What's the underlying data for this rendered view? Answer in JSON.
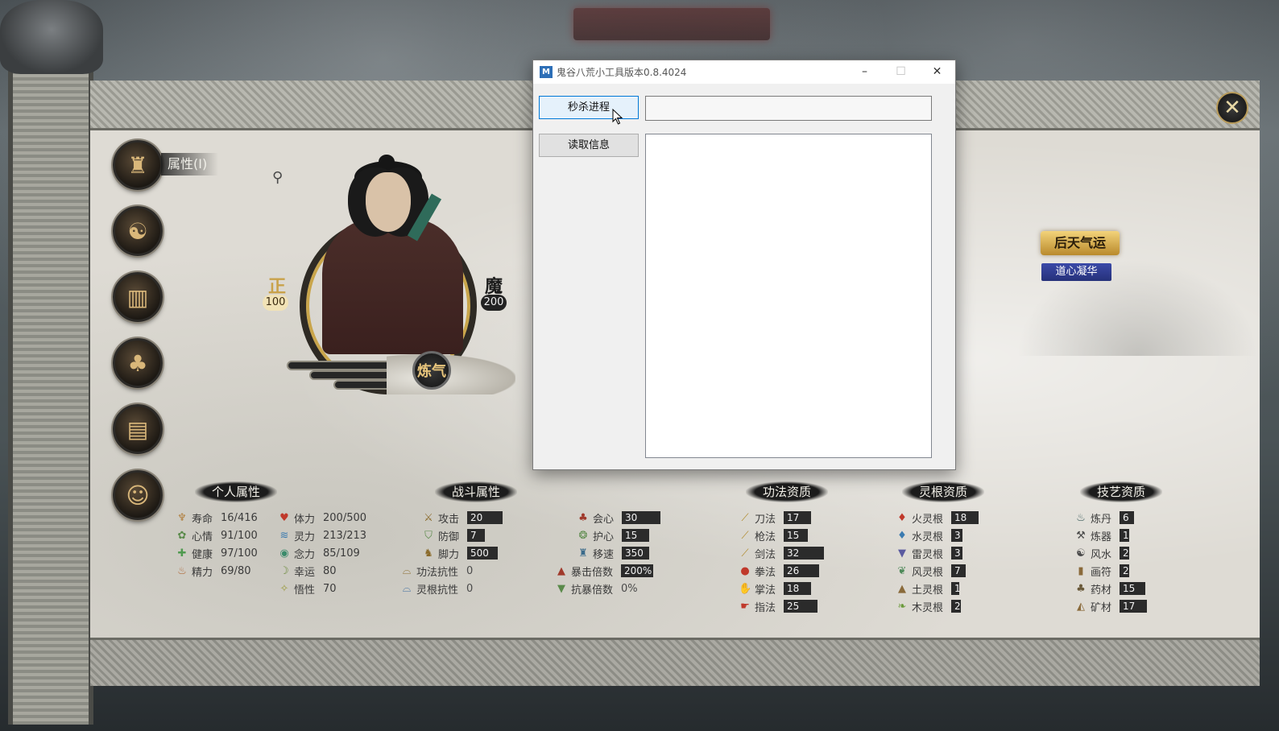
{
  "tool_window": {
    "title": "鬼谷八荒小工具版本0.8.4024",
    "icon": "app-logo-icon",
    "buttons": {
      "kill_process": "秒杀进程",
      "read_info": "读取信息"
    },
    "controls": {
      "minimize": "–",
      "maximize": "☐",
      "close": "✕"
    },
    "input_value": "",
    "output_text": ""
  },
  "game": {
    "nav_label": "属性(I)",
    "realm": "炼气",
    "left_glyph": "正",
    "left_value": "100",
    "right_glyph": "魔",
    "right_value": "200",
    "luck_button": "后天气运",
    "dao_button": "道心凝华",
    "sections": {
      "personal": "个人属性",
      "combat": "战斗属性",
      "gongfa": "功法资质",
      "linggen": "灵根资质",
      "jiyi": "技艺资质"
    },
    "personal_stats": [
      {
        "label": "寿命",
        "value": "16/416",
        "icon": "lifespan-icon"
      },
      {
        "label": "心情",
        "value": "91/100",
        "icon": "mood-icon"
      },
      {
        "label": "健康",
        "value": "97/100",
        "icon": "health-icon"
      },
      {
        "label": "精力",
        "value": "69/80",
        "icon": "energy-icon"
      }
    ],
    "personal_stats2": [
      {
        "label": "体力",
        "value": "200/500",
        "icon": "heart-icon"
      },
      {
        "label": "灵力",
        "value": "213/213",
        "icon": "spirit-icon"
      },
      {
        "label": "念力",
        "value": "85/109",
        "icon": "eye-icon"
      },
      {
        "label": "幸运",
        "value": "80",
        "icon": "luck-icon"
      },
      {
        "label": "悟性",
        "value": "70",
        "icon": "insight-icon"
      }
    ],
    "combat_stats": [
      {
        "label": "攻击",
        "value": "20",
        "icon": "swords-icon"
      },
      {
        "label": "防御",
        "value": "7",
        "icon": "shield-icon"
      },
      {
        "label": "脚力",
        "value": "500",
        "icon": "boot-icon"
      },
      {
        "label": "功法抗性",
        "value": "0",
        "icon": "resist-icon"
      },
      {
        "label": "灵根抗性",
        "value": "0",
        "icon": "resist-icon"
      }
    ],
    "combat_stats2": [
      {
        "label": "会心",
        "value": "30",
        "icon": "crit-icon"
      },
      {
        "label": "护心",
        "value": "15",
        "icon": "guard-icon"
      },
      {
        "label": "移速",
        "value": "350",
        "icon": "speed-icon"
      },
      {
        "label": "暴击倍数",
        "value": "200%",
        "icon": "crit-mult-icon"
      },
      {
        "label": "抗暴倍数",
        "value": "0%",
        "icon": "anti-crit-icon"
      }
    ],
    "gongfa_stats": [
      {
        "label": "刀法",
        "value": "17",
        "icon": "blade-icon"
      },
      {
        "label": "枪法",
        "value": "15",
        "icon": "spear-icon"
      },
      {
        "label": "剑法",
        "value": "32",
        "icon": "sword-icon"
      },
      {
        "label": "拳法",
        "value": "26",
        "icon": "fist-icon"
      },
      {
        "label": "掌法",
        "value": "18",
        "icon": "palm-icon"
      },
      {
        "label": "指法",
        "value": "25",
        "icon": "finger-icon"
      }
    ],
    "linggen_stats": [
      {
        "label": "火灵根",
        "value": "18",
        "icon": "fire-icon"
      },
      {
        "label": "水灵根",
        "value": "3",
        "icon": "water-icon"
      },
      {
        "label": "雷灵根",
        "value": "3",
        "icon": "thunder-icon"
      },
      {
        "label": "风灵根",
        "value": "7",
        "icon": "wind-icon"
      },
      {
        "label": "土灵根",
        "value": "1",
        "icon": "earth-icon"
      },
      {
        "label": "木灵根",
        "value": "2",
        "icon": "wood-icon"
      }
    ],
    "jiyi_stats": [
      {
        "label": "炼丹",
        "value": "6",
        "icon": "alchemy-icon"
      },
      {
        "label": "炼器",
        "value": "1",
        "icon": "forge-icon"
      },
      {
        "label": "风水",
        "value": "2",
        "icon": "fengshui-icon"
      },
      {
        "label": "画符",
        "value": "2",
        "icon": "talisman-icon"
      },
      {
        "label": "药材",
        "value": "15",
        "icon": "herb-icon"
      },
      {
        "label": "矿材",
        "value": "17",
        "icon": "ore-icon"
      }
    ]
  }
}
